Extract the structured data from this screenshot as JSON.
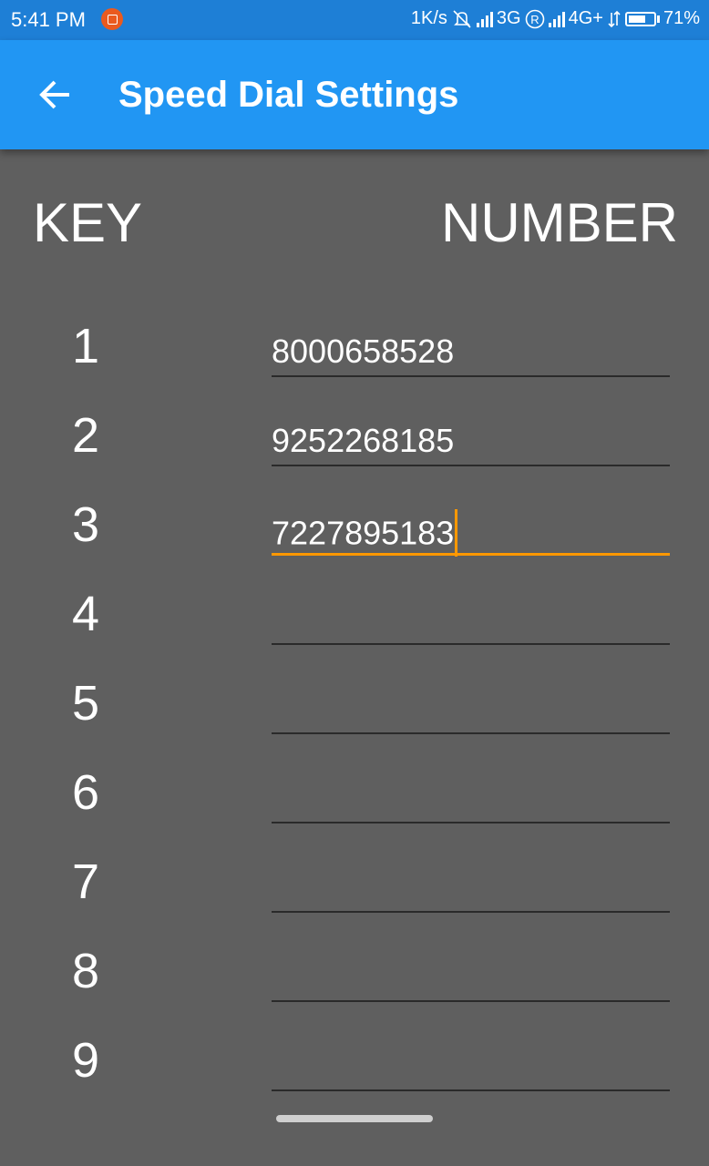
{
  "status_bar": {
    "time": "5:41 PM",
    "notification_icon": "app-notification-icon",
    "speed": "1K/s",
    "network_1": "3G",
    "roaming_icon": "roaming-r-icon",
    "network_2": "4G+",
    "battery_percent": "71%",
    "battery_level": 0.71
  },
  "app_bar": {
    "back_icon": "arrow-back-icon",
    "title": "Speed Dial Settings",
    "color": "#2196f3"
  },
  "table": {
    "key_header": "KEY",
    "number_header": "NUMBER",
    "rows": [
      {
        "key": "1",
        "number": "8000658528",
        "focused": false
      },
      {
        "key": "2",
        "number": "9252268185",
        "focused": false
      },
      {
        "key": "3",
        "number": "7227895183",
        "focused": true
      },
      {
        "key": "4",
        "number": "",
        "focused": false
      },
      {
        "key": "5",
        "number": "",
        "focused": false
      },
      {
        "key": "6",
        "number": "",
        "focused": false
      },
      {
        "key": "7",
        "number": "",
        "focused": false
      },
      {
        "key": "8",
        "number": "",
        "focused": false
      },
      {
        "key": "9",
        "number": "",
        "focused": false
      }
    ]
  },
  "colors": {
    "background": "#5f5f5f",
    "accent": "#ff9800",
    "divider": "#2a2a2a"
  }
}
